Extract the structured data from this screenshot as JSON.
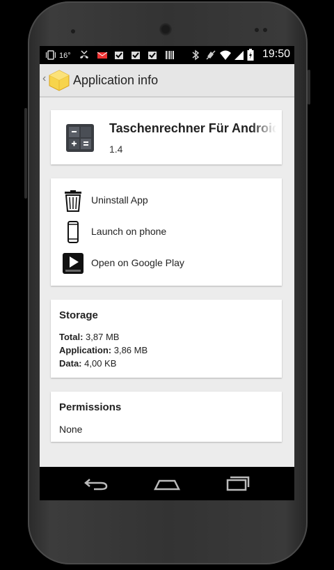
{
  "status_bar": {
    "temperature": "16°",
    "time": "19:50"
  },
  "action_bar": {
    "title": "Application info"
  },
  "app": {
    "name": "Taschenrechner Für Android",
    "version": "1.4"
  },
  "actions": [
    {
      "label": "Uninstall App",
      "icon": "trash-icon"
    },
    {
      "label": "Launch on phone",
      "icon": "phone-icon"
    },
    {
      "label": "Open on Google Play",
      "icon": "google-play-icon"
    }
  ],
  "storage": {
    "title": "Storage",
    "total_label": "Total:",
    "total_value": "3,87 MB",
    "application_label": "Application:",
    "application_value": "3,86 MB",
    "data_label": "Data:",
    "data_value": "4,00 KB"
  },
  "permissions": {
    "title": "Permissions",
    "value": "None"
  },
  "colors": {
    "content_background": "#ececec",
    "action_bar": "#e6e6e6",
    "logo_yellow": "#f7d44c"
  }
}
